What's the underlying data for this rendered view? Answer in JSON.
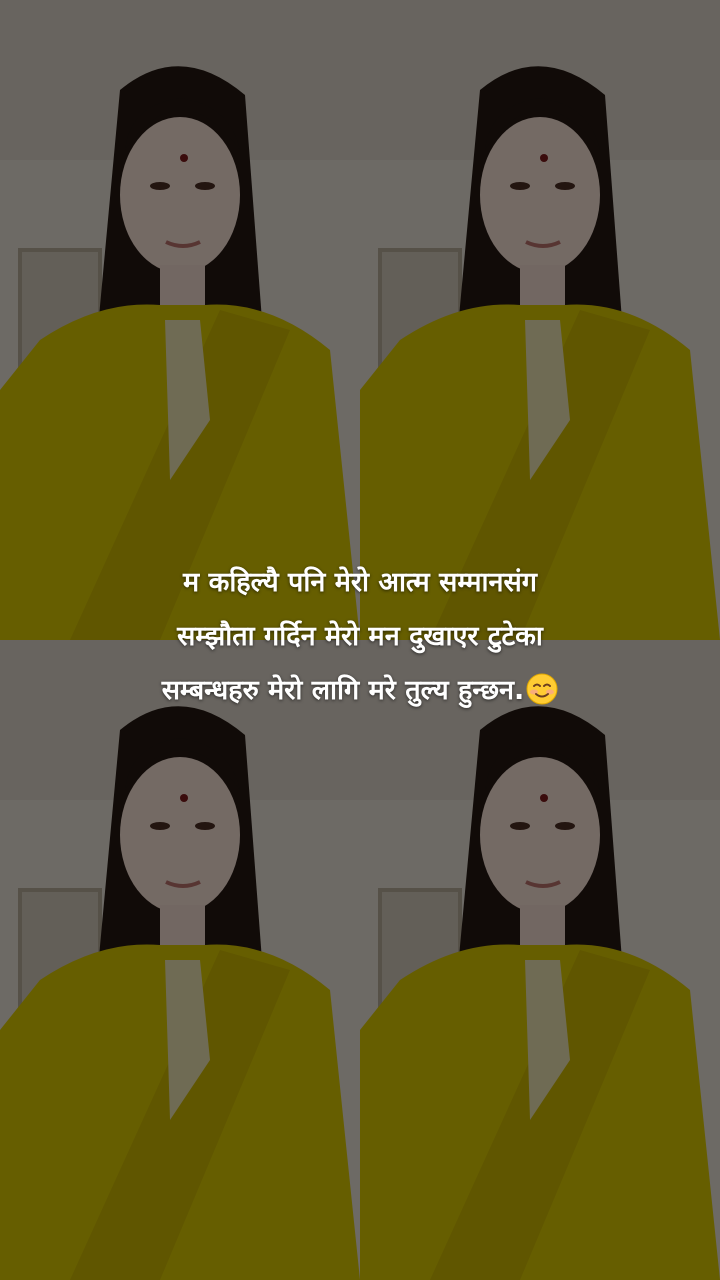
{
  "caption": {
    "line1": "म कहिल्यै पनि मेरो आत्म सम्मानसंग",
    "line2": "सम्झौता गर्दिन मेरो मन दुखाएर टुटेका",
    "line3": "सम्बन्धहरु मेरो लागि मरे तुल्य हुन्छन.",
    "emoji": "smiling-face-icon"
  },
  "photo_tiles": {
    "count": 4,
    "layout": "2x2 repeated portrait photo"
  },
  "colors": {
    "outfit": "#d6c400",
    "wall": "#e8e3da",
    "hair": "#241812",
    "overlay": "rgba(0,0,0,0.52)",
    "text": "#ffffff"
  }
}
